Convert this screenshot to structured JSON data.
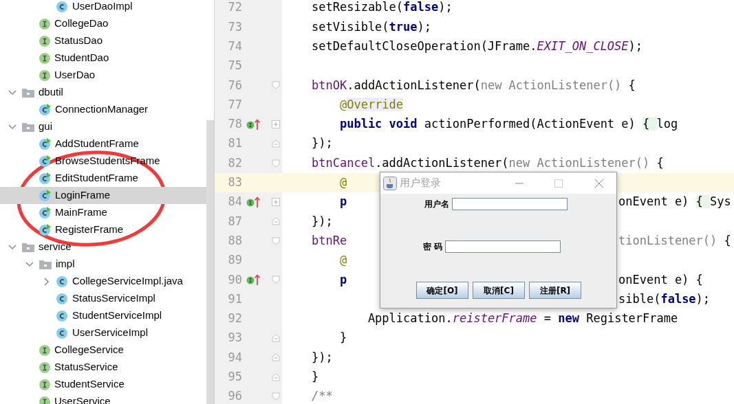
{
  "project_tree": [
    {
      "children": [
        {
          "children": [
            {
              "label": "UserDaoImpl",
              "kind": "class",
              "selected": false
            }
          ]
        },
        {
          "label": "CollegeDao",
          "kind": "interface",
          "selected": false
        },
        {
          "label": "StatusDao",
          "kind": "interface",
          "selected": false
        },
        {
          "label": "StudentDao",
          "kind": "interface",
          "selected": false
        },
        {
          "label": "UserDao",
          "kind": "interface",
          "selected": false
        }
      ]
    },
    {
      "label": "dbutil",
      "kind": "package",
      "expanded": true,
      "selected": false,
      "children": [
        {
          "label": "ConnectionManager",
          "kind": "runnable",
          "selected": false
        }
      ]
    },
    {
      "label": "gui",
      "kind": "package",
      "expanded": true,
      "selected": false,
      "children": [
        {
          "label": "AddStudentFrame",
          "kind": "runnable",
          "selected": false
        },
        {
          "label": "BrowseStudentsFrame",
          "kind": "runnable",
          "selected": false
        },
        {
          "label": "EditStudentFrame",
          "kind": "runnable",
          "selected": false
        },
        {
          "label": "LoginFrame",
          "kind": "runnable",
          "selected": true
        },
        {
          "label": "MainFrame",
          "kind": "runnable",
          "selected": false
        },
        {
          "label": "RegisterFrame",
          "kind": "runnable",
          "selected": false
        }
      ]
    },
    {
      "label": "service",
      "kind": "package",
      "expanded": true,
      "selected": false,
      "children": [
        {
          "label": "impl",
          "kind": "package",
          "expanded": true,
          "selected": false,
          "children": [
            {
              "label": "CollegeServiceImpl.java",
              "kind": "class",
              "expanded": false,
              "selected": false
            },
            {
              "label": "StatusServiceImpl",
              "kind": "class",
              "selected": false
            },
            {
              "label": "StudentServiceImpl",
              "kind": "class",
              "selected": false
            },
            {
              "label": "UserServiceImpl",
              "kind": "class",
              "selected": false
            }
          ]
        },
        {
          "label": "CollegeService",
          "kind": "interface",
          "selected": false
        },
        {
          "label": "StatusService",
          "kind": "interface",
          "selected": false
        },
        {
          "label": "StudentService",
          "kind": "interface",
          "selected": false
        },
        {
          "label": "UserService",
          "kind": "interface",
          "selected": false
        }
      ]
    }
  ],
  "annotations": [
    {
      "kind": "ellipse"
    }
  ],
  "editor_lines": [
    {
      "children": [
        {
          "number": "72",
          "current": false,
          "marker": false,
          "tokens": [
            {
              "text": "setResizable(",
              "kind": "plain"
            },
            {
              "text": "false",
              "kind": "keyword"
            },
            {
              "text": ");",
              "kind": "plain"
            }
          ]
        },
        {
          "number": "73",
          "current": false,
          "marker": false,
          "tokens": [
            {
              "text": "setVisible(",
              "kind": "plain"
            },
            {
              "text": "true",
              "kind": "keyword"
            },
            {
              "text": ");",
              "kind": "plain"
            }
          ]
        },
        {
          "number": "74",
          "current": false,
          "marker": false,
          "tokens": [
            {
              "text": "setDefaultCloseOperation(JFrame.",
              "kind": "plain"
            },
            {
              "text": "EXIT_ON_CLOSE",
              "kind": "static"
            },
            {
              "text": ");",
              "kind": "plain"
            }
          ]
        },
        {
          "number": "75",
          "current": false,
          "marker": false
        },
        {
          "number": "76",
          "current": false,
          "marker": false,
          "fold": {
            "kind": "start"
          },
          "tokens": [
            {
              "text": "btnOK",
              "kind": "field"
            },
            {
              "text": ".addActionListener(",
              "kind": "plain"
            },
            {
              "text": "new ActionListener()",
              "kind": "dim"
            },
            {
              "text": " {",
              "kind": "plain"
            }
          ],
          "children": [
            {
              "number": "77",
              "current": false,
              "marker": false,
              "tokens": [
                {
                  "text": "@",
                  "kind": "annotation"
                },
                {
                  "text": "Override",
                  "kind": "annotation-hl"
                }
              ]
            },
            {
              "number": "78",
              "current": false,
              "marker": true,
              "fold": {
                "kind": "collapsed"
              },
              "tokens": [
                {
                  "text": "public void",
                  "kind": "keyword"
                },
                {
                  "text": " actionPerformed(ActionEvent e) ",
                  "kind": "plain"
                },
                {
                  "text": "{ ",
                  "kind": "folded"
                },
                {
                  "text": "log",
                  "kind": "plain"
                }
              ]
            }
          ]
        },
        {
          "number": "81",
          "current": false,
          "marker": false,
          "fold": {
            "kind": "end"
          },
          "tokens": [
            {
              "text": "});",
              "kind": "plain"
            }
          ]
        },
        {
          "number": "82",
          "current": false,
          "marker": false,
          "fold": {
            "kind": "start"
          },
          "tokens": [
            {
              "text": "btnCancel",
              "kind": "field"
            },
            {
              "text": ".addActionListener(",
              "kind": "plain"
            },
            {
              "text": "new ActionListener()",
              "kind": "dim"
            },
            {
              "text": " {",
              "kind": "plain"
            }
          ],
          "children": [
            {
              "number": "83",
              "current": true,
              "marker": false,
              "tokens": [
                {
                  "text": "@",
                  "kind": "annotation"
                }
              ]
            },
            {
              "number": "84",
              "current": false,
              "marker": true,
              "fold": {
                "kind": "collapsed"
              },
              "tokens": [
                {
                  "text": "p",
                  "kind": "keyword"
                }
              ],
              "right": [
                {
                  "text": "onEvent e) ",
                  "kind": "plain"
                },
                {
                  "text": "{ ",
                  "kind": "folded"
                },
                {
                  "text": "Sys",
                  "kind": "plain"
                }
              ]
            }
          ]
        },
        {
          "number": "87",
          "current": false,
          "marker": false,
          "fold": {
            "kind": "end"
          },
          "tokens": [
            {
              "text": "});",
              "kind": "plain"
            }
          ]
        },
        {
          "number": "88",
          "current": false,
          "marker": false,
          "fold": {
            "kind": "start"
          },
          "tokens": [
            {
              "text": "btnRe",
              "kind": "field"
            }
          ],
          "right": [
            {
              "text": "tionListener()",
              "kind": "dim"
            },
            {
              "text": " {",
              "kind": "plain"
            }
          ],
          "children": [
            {
              "number": "89",
              "current": false,
              "marker": false,
              "tokens": [
                {
                  "text": "@",
                  "kind": "annotation"
                }
              ]
            },
            {
              "number": "90",
              "current": false,
              "marker": true,
              "fold": {
                "kind": "start"
              },
              "tokens": [
                {
                  "text": "p",
                  "kind": "keyword"
                }
              ],
              "right": [
                {
                  "text": "onEvent e) {",
                  "kind": "plain"
                }
              ],
              "children": [
                {
                  "number": "91",
                  "current": false,
                  "marker": false,
                  "right": [
                    {
                      "text": "sible(",
                      "kind": "plain"
                    },
                    {
                      "text": "false",
                      "kind": "keyword"
                    },
                    {
                      "text": ");",
                      "kind": "plain"
                    }
                  ]
                },
                {
                  "number": "92",
                  "current": false,
                  "marker": false,
                  "tokens": [
                    {
                      "text": "Application.",
                      "kind": "plain"
                    },
                    {
                      "text": "reisterFrame",
                      "kind": "static"
                    },
                    {
                      "text": " = ",
                      "kind": "plain"
                    },
                    {
                      "text": "new",
                      "kind": "keyword"
                    },
                    {
                      "text": " RegisterFrame",
                      "kind": "plain"
                    }
                  ]
                }
              ]
            },
            {
              "number": "93",
              "current": false,
              "marker": false,
              "fold": {
                "kind": "end"
              },
              "tokens": [
                {
                  "text": "}",
                  "kind": "plain"
                }
              ]
            }
          ]
        },
        {
          "number": "94",
          "current": false,
          "marker": false,
          "fold": {
            "kind": "end"
          },
          "tokens": [
            {
              "text": "});",
              "kind": "plain"
            }
          ]
        }
      ]
    },
    {
      "number": "95",
      "current": false,
      "marker": false,
      "fold": {
        "kind": "end"
      },
      "tokens": [
        {
          "text": "}",
          "kind": "plain"
        }
      ]
    },
    {
      "number": "96",
      "current": false,
      "marker": false,
      "fold": {
        "kind": "start"
      },
      "tokens": [
        {
          "text": "/**",
          "kind": "comment"
        }
      ]
    }
  ],
  "dialog": {
    "title": "用户登录",
    "focused": false,
    "fields": [
      {
        "label": "用户名"
      },
      {
        "label": "密 码"
      }
    ],
    "buttons": [
      "确定[O]",
      "取消[C]",
      "注册[R]"
    ]
  }
}
